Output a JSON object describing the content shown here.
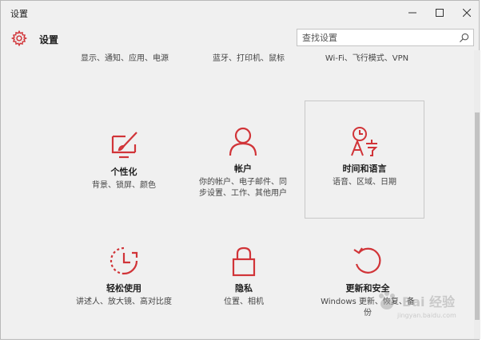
{
  "window": {
    "title": "设置"
  },
  "header": {
    "title": "设置",
    "icon": "gear-icon"
  },
  "search": {
    "placeholder": "查找设置",
    "icon": "search-icon"
  },
  "accent_color": "#d13438",
  "top_row": [
    {
      "desc": "显示、通知、应用、电源"
    },
    {
      "desc": "蓝牙、打印机、鼠标"
    },
    {
      "desc": "Wi-Fi、飞行模式、VPN"
    }
  ],
  "tiles": [
    {
      "label": "个性化",
      "desc": "背景、锁屏、颜色",
      "icon": "personalization-icon"
    },
    {
      "label": "帐户",
      "desc": "你的帐户、电子邮件、同步设置、工作、其他用户",
      "icon": "account-icon"
    },
    {
      "label": "时间和语言",
      "desc": "语音、区域、日期",
      "icon": "time-language-icon"
    },
    {
      "label": "轻松使用",
      "desc": "讲述人、放大镜、高对比度",
      "icon": "ease-of-access-icon"
    },
    {
      "label": "隐私",
      "desc": "位置、相机",
      "icon": "privacy-icon"
    },
    {
      "label": "更新和安全",
      "desc": "Windows 更新、恢复、备份",
      "icon": "update-security-icon"
    }
  ],
  "watermark": {
    "text": "Bai 经验",
    "sub": "jingyan.baidu.com"
  }
}
